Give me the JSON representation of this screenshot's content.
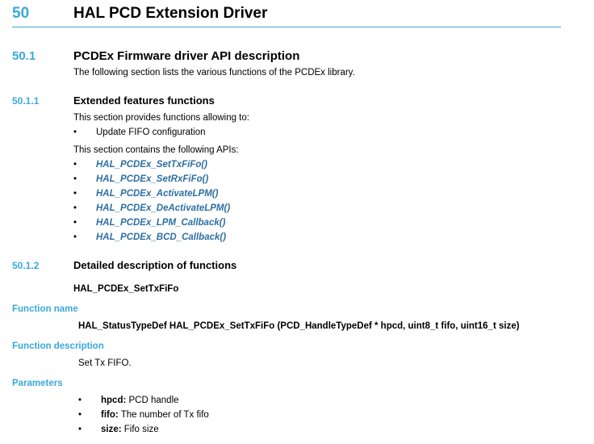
{
  "chapter": {
    "number": "50",
    "title": "HAL PCD Extension Driver"
  },
  "section": {
    "number": "50.1",
    "title": "PCDEx Firmware driver API description",
    "intro": "The following section lists the various functions of the PCDEx library."
  },
  "subsection1": {
    "number": "50.1.1",
    "title": "Extended features functions",
    "provides_text": "This section provides functions allowing to:",
    "features": [
      "Update FIFO configuration"
    ],
    "contains_text": "This section contains the following APIs:",
    "apis": [
      "HAL_PCDEx_SetTxFiFo()",
      "HAL_PCDEx_SetRxFiFo()",
      "HAL_PCDEx_ActivateLPM()",
      "HAL_PCDEx_DeActivateLPM()",
      "HAL_PCDEx_LPM_Callback()",
      "HAL_PCDEx_BCD_Callback()"
    ]
  },
  "subsection2": {
    "number": "50.1.2",
    "title": "Detailed description of functions",
    "function_heading": "HAL_PCDEx_SetTxFiFo"
  },
  "function": {
    "name_label": "Function name",
    "signature": "HAL_StatusTypeDef HAL_PCDEx_SetTxFiFo (PCD_HandleTypeDef * hpcd, uint8_t fifo, uint16_t size)",
    "description_label": "Function description",
    "description": "Set Tx FIFO.",
    "parameters_label": "Parameters",
    "parameters": [
      {
        "name": "hpcd:",
        "desc": "PCD handle"
      },
      {
        "name": "fifo:",
        "desc": "The number of Tx fifo"
      },
      {
        "name": "size:",
        "desc": "Fifo size"
      }
    ]
  },
  "bullet_glyph": "•",
  "colors": {
    "accent": "#39a9dc",
    "link": "#2d6fa3",
    "text": "#000000"
  }
}
